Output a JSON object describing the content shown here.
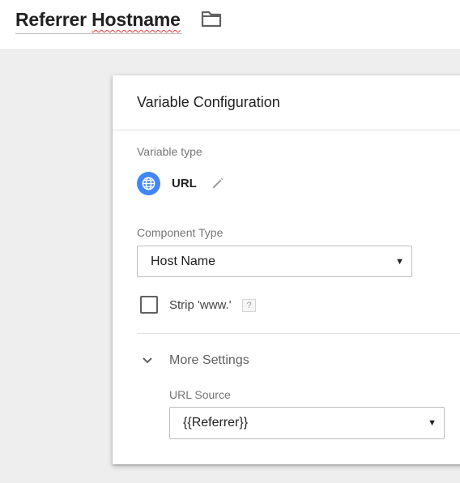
{
  "header": {
    "title_first": "Referrer",
    "title_second": "Hostname",
    "folder_icon": "folder-icon"
  },
  "card": {
    "title": "Variable Configuration",
    "variable_type_label": "Variable type",
    "variable_type": {
      "name": "URL",
      "icon": "globe-icon",
      "icon_color": "#4285f4",
      "edit_icon": "pencil-icon"
    },
    "component_type_label": "Component Type",
    "component_type_value": "Host Name",
    "strip_www": {
      "label": "Strip 'www.'",
      "checked": false,
      "help": "?"
    },
    "more_settings": {
      "label": "More Settings",
      "expanded": true,
      "url_source_label": "URL Source",
      "url_source_value": "{{Referrer}}"
    }
  },
  "colors": {
    "accent": "#4285f4",
    "spellcheck": "#e53935",
    "background": "#eeeeee"
  }
}
